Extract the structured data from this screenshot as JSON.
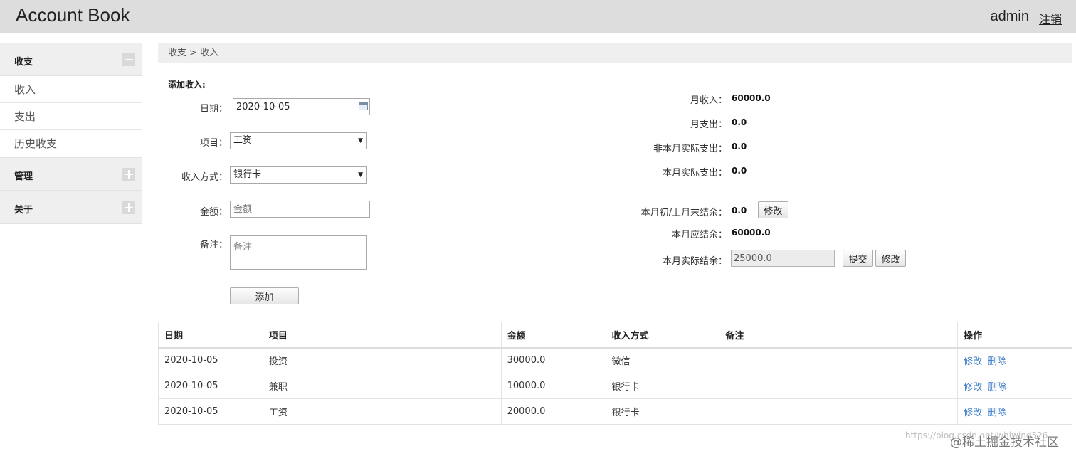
{
  "header": {
    "app_title": "Account Book",
    "user": "admin",
    "logout_label": "注销"
  },
  "sidebar": {
    "groups": [
      {
        "title": "收支",
        "state": "expanded",
        "items": [
          "收入",
          "支出",
          "历史收支"
        ]
      },
      {
        "title": "管理",
        "state": "collapsed"
      },
      {
        "title": "关于",
        "state": "collapsed"
      }
    ]
  },
  "breadcrumb": "收支 > 收入",
  "form": {
    "title": "添加收入:",
    "date_label": "日期：",
    "date_value": "2020-10-05",
    "item_label": "项目：",
    "item_value": "工资",
    "method_label": "收入方式：",
    "method_value": "银行卡",
    "amount_label": "金额：",
    "amount_placeholder": "金额",
    "note_label": "备注：",
    "note_placeholder": "备注",
    "add_button": "添加"
  },
  "summary": {
    "month_income_label": "月收入：",
    "month_income": "60000.0",
    "month_expense_label": "月支出：",
    "month_expense": "0.0",
    "non_month_actual_label": "非本月实际支出：",
    "non_month_actual": "0.0",
    "month_actual_label": "本月实际支出：",
    "month_actual": "0.0",
    "opening_label": "本月初/上月末结余：",
    "opening": "0.0",
    "opening_edit": "修改",
    "expected_label": "本月应结余：",
    "expected": "60000.0",
    "actual_balance_label": "本月实际结余：",
    "actual_balance": "25000.0",
    "submit_button": "提交",
    "edit_button": "修改"
  },
  "table": {
    "columns": [
      "日期",
      "项目",
      "金额",
      "收入方式",
      "备注",
      "操作"
    ],
    "rows": [
      {
        "date": "2020-10-05",
        "item": "投资",
        "amount": "30000.0",
        "method": "微信",
        "note": ""
      },
      {
        "date": "2020-10-05",
        "item": "兼职",
        "amount": "10000.0",
        "method": "银行卡",
        "note": ""
      },
      {
        "date": "2020-10-05",
        "item": "工资",
        "amount": "20000.0",
        "method": "银行卡",
        "note": ""
      }
    ],
    "edit_label": "修改",
    "delete_label": "删除"
  },
  "watermark": {
    "url": "https://blog.csdn.net/whiwind526",
    "brand": "@稀土掘金技术社区"
  },
  "colors": {
    "topbar": "#dddddd",
    "sidebar_header": "#efefef",
    "link": "#3a7bc8"
  }
}
